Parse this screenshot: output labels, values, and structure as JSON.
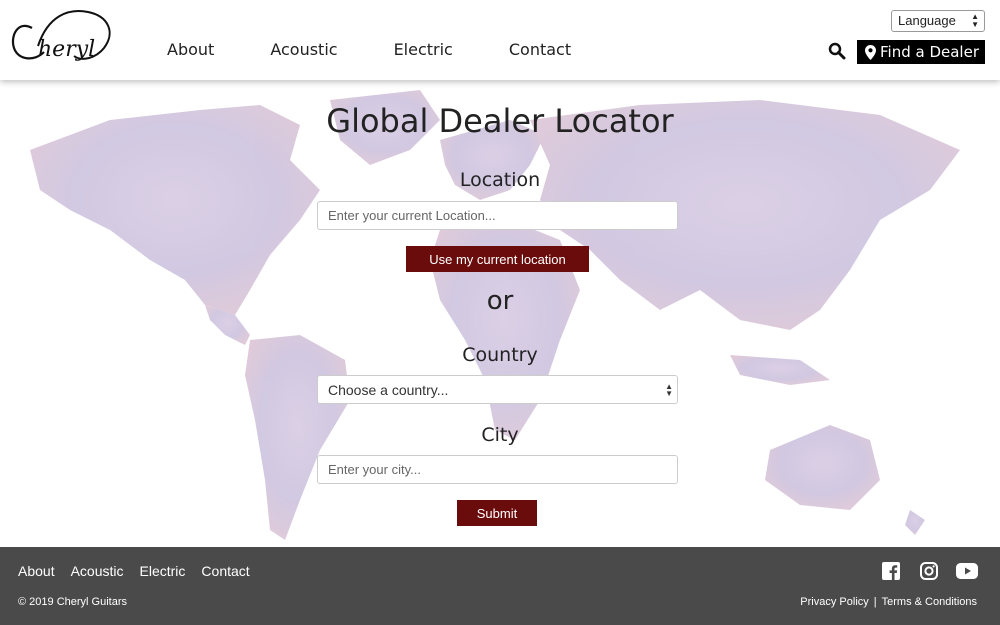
{
  "header": {
    "logo_text": "Cheryl",
    "nav": [
      "About",
      "Acoustic",
      "Electric",
      "Contact"
    ],
    "language_label": "Language",
    "find_dealer_label": "Find a Dealer"
  },
  "main": {
    "title": "Global Dealer Locator",
    "location_label": "Location",
    "location_placeholder": "Enter your current Location...",
    "use_location_label": "Use my current location",
    "or_text": "or",
    "country_label": "Country",
    "country_selected": "Choose a country...",
    "city_label": "City",
    "city_placeholder": "Enter your city...",
    "submit_label": "Submit"
  },
  "footer": {
    "nav": [
      "About",
      "Acoustic",
      "Electric",
      "Contact"
    ],
    "copyright": "© 2019 Cheryl Guitars",
    "privacy_label": "Privacy Policy",
    "separator": "|",
    "terms_label": "Terms & Conditions",
    "social_icons": [
      "facebook-icon",
      "instagram-icon",
      "youtube-icon"
    ]
  },
  "colors": {
    "accent_button": "#6b0c0c",
    "footer_bg": "#4a4a4a",
    "dealer_button_bg": "#000000"
  }
}
